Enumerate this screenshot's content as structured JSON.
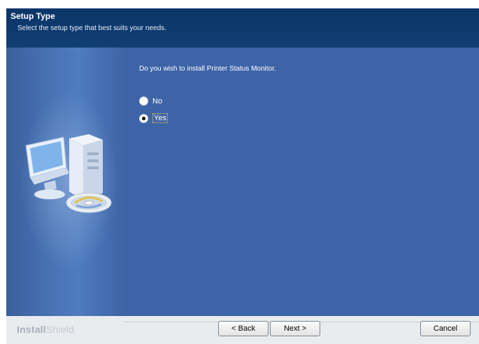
{
  "header": {
    "title": "Setup Type",
    "subtitle": "Select the setup type that best suits your needs."
  },
  "content": {
    "question": "Do you wish to install Printer Status Monitor.",
    "options": [
      {
        "label": "No",
        "selected": false
      },
      {
        "label": "Yes",
        "selected": true
      }
    ]
  },
  "footer": {
    "brand_bold": "Install",
    "brand_light": "Shield",
    "back_label": "< Back",
    "next_label": "Next >",
    "cancel_label": "Cancel"
  },
  "icons": {
    "illustration": "computer-cd-illustration-icon"
  },
  "colors": {
    "header_bg": "#0b3567",
    "body_bg": "#3e64a8",
    "footer_bg": "#e9ecef",
    "focus_outline": "#f2d24a"
  }
}
